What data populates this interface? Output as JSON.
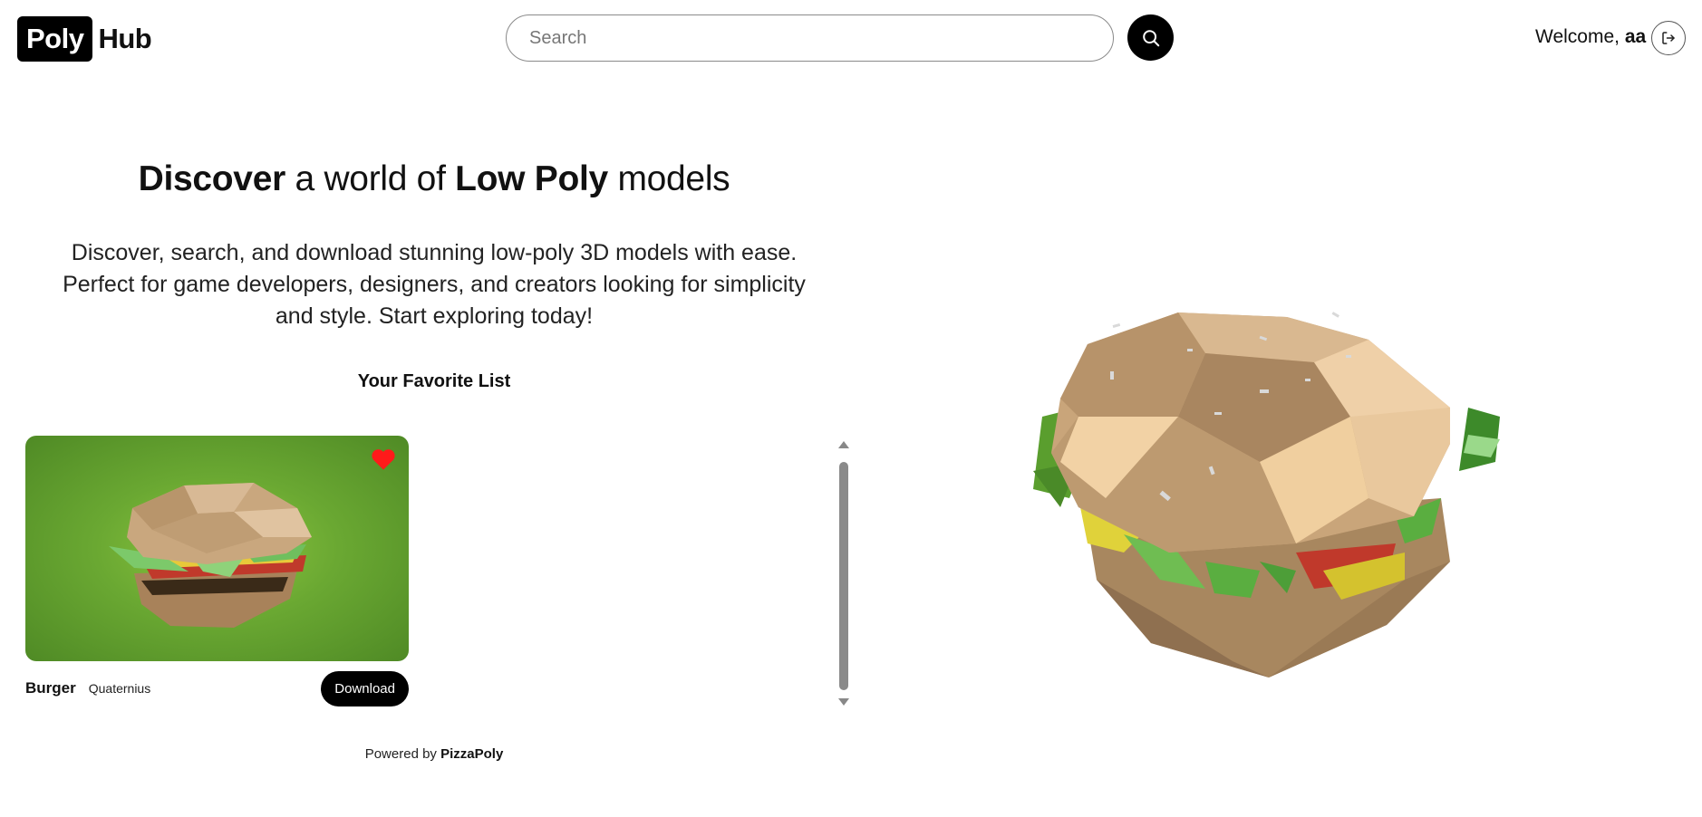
{
  "header": {
    "logo_box": "Poly",
    "logo_text": "Hub",
    "search_placeholder": "Search",
    "search_icon": "search-icon",
    "welcome_prefix": "Welcome,",
    "username": "aa",
    "logout_icon": "logout-icon"
  },
  "hero": {
    "title_part1": "Discover",
    "title_part2": " a world of ",
    "title_part3": "Low Poly",
    "title_part4": " models",
    "description": "Discover, search, and download stunning low-poly 3D models with ease. Perfect for game developers, designers, and creators looking for simplicity and style. Start exploring today!",
    "favorites_title": "Your Favorite List"
  },
  "favorites": [
    {
      "name": "Burger",
      "author": "Quaternius",
      "download_label": "Download",
      "favorited": true
    }
  ],
  "footer": {
    "powered_prefix": "Powered by ",
    "powered_brand": "PizzaPoly"
  },
  "colors": {
    "accent": "#000000",
    "heart": "#ff1a1a",
    "card_bg": "#6aa832"
  }
}
